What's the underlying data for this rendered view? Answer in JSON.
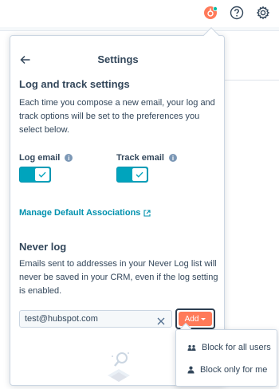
{
  "header": {
    "icons": [
      "hubspot-sprocket-icon",
      "help-icon",
      "settings-gear-icon"
    ],
    "notification_color": "#00bda5",
    "brand_color": "#ff7a59"
  },
  "popover": {
    "title": "Settings",
    "log_track": {
      "heading": "Log and track settings",
      "description": "Each time you compose a new email, your log and track options will be set to the preferences you select below.",
      "log_email": {
        "label": "Log email",
        "enabled": true
      },
      "track_email": {
        "label": "Track email",
        "enabled": true
      }
    },
    "associations_link": "Manage Default Associations",
    "never_log": {
      "heading": "Never log",
      "description": "Emails sent to addresses in your Never Log list will never be saved in your CRM, even if the log setting is enabled.",
      "email_value": "test@hubspot.com",
      "add_label": "Add"
    }
  },
  "add_menu": {
    "items": [
      {
        "label": "Block for all users",
        "icon": "users-icon"
      },
      {
        "label": "Block only for me",
        "icon": "user-icon"
      }
    ]
  },
  "colors": {
    "accent": "#0091ae",
    "toggle_on": "#00a4bd",
    "button": "#ff7a59",
    "text": "#33475b"
  }
}
